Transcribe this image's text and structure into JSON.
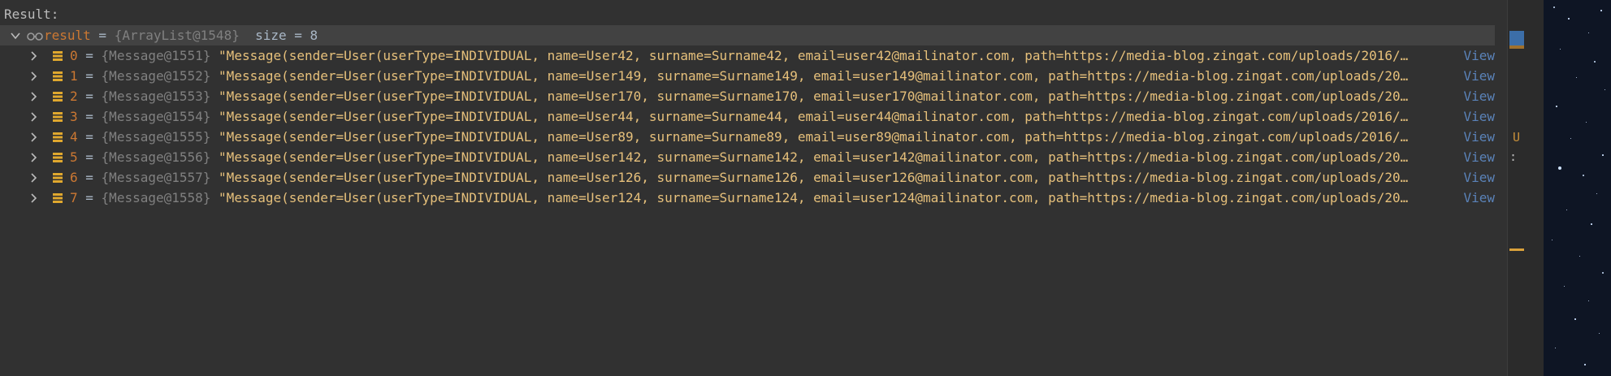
{
  "panel": {
    "header": "Result:",
    "root": {
      "name": "result",
      "eq": " = ",
      "ref": "{ArrayList@1548}",
      "size": "  size = 8"
    },
    "items": [
      {
        "index": "0",
        "ref": "{Message@1551}",
        "value": "\"Message(sender=User(userType=INDIVIDUAL, name=User42, surname=Surname42, email=user42@mailinator.com, path=https://media-blog.zingat.com/uploads/2016/…",
        "view": "View"
      },
      {
        "index": "1",
        "ref": "{Message@1552}",
        "value": "\"Message(sender=User(userType=INDIVIDUAL, name=User149, surname=Surname149, email=user149@mailinator.com, path=https://media-blog.zingat.com/uploads/20…",
        "view": "View"
      },
      {
        "index": "2",
        "ref": "{Message@1553}",
        "value": "\"Message(sender=User(userType=INDIVIDUAL, name=User170, surname=Surname170, email=user170@mailinator.com, path=https://media-blog.zingat.com/uploads/20…",
        "view": "View"
      },
      {
        "index": "3",
        "ref": "{Message@1554}",
        "value": "\"Message(sender=User(userType=INDIVIDUAL, name=User44, surname=Surname44, email=user44@mailinator.com, path=https://media-blog.zingat.com/uploads/2016/…",
        "view": "View"
      },
      {
        "index": "4",
        "ref": "{Message@1555}",
        "value": "\"Message(sender=User(userType=INDIVIDUAL, name=User89, surname=Surname89, email=user89@mailinator.com, path=https://media-blog.zingat.com/uploads/2016/…",
        "view": "View"
      },
      {
        "index": "5",
        "ref": "{Message@1556}",
        "value": "\"Message(sender=User(userType=INDIVIDUAL, name=User142, surname=Surname142, email=user142@mailinator.com, path=https://media-blog.zingat.com/uploads/20…",
        "view": "View"
      },
      {
        "index": "6",
        "ref": "{Message@1557}",
        "value": "\"Message(sender=User(userType=INDIVIDUAL, name=User126, surname=Surname126, email=user126@mailinator.com, path=https://media-blog.zingat.com/uploads/20…",
        "view": "View"
      },
      {
        "index": "7",
        "ref": "{Message@1558}",
        "value": "\"Message(sender=User(userType=INDIVIDUAL, name=User124, surname=Surname124, email=user124@mailinator.com, path=https://media-blog.zingat.com/uploads/20…",
        "view": "View"
      }
    ]
  },
  "gutter": {
    "u_label": "U",
    "colon_label": ":"
  },
  "icons": {
    "expand": "chevron-down-icon",
    "collapse": "chevron-right-icon",
    "watch": "glasses-icon",
    "list_item": "list-item-icon"
  },
  "colors": {
    "panel_bg": "#313131",
    "selected_row": "#424242",
    "keyword": "#cc7832",
    "ref": "#808080",
    "string": "#e6c07b",
    "link": "#5a82b8"
  }
}
